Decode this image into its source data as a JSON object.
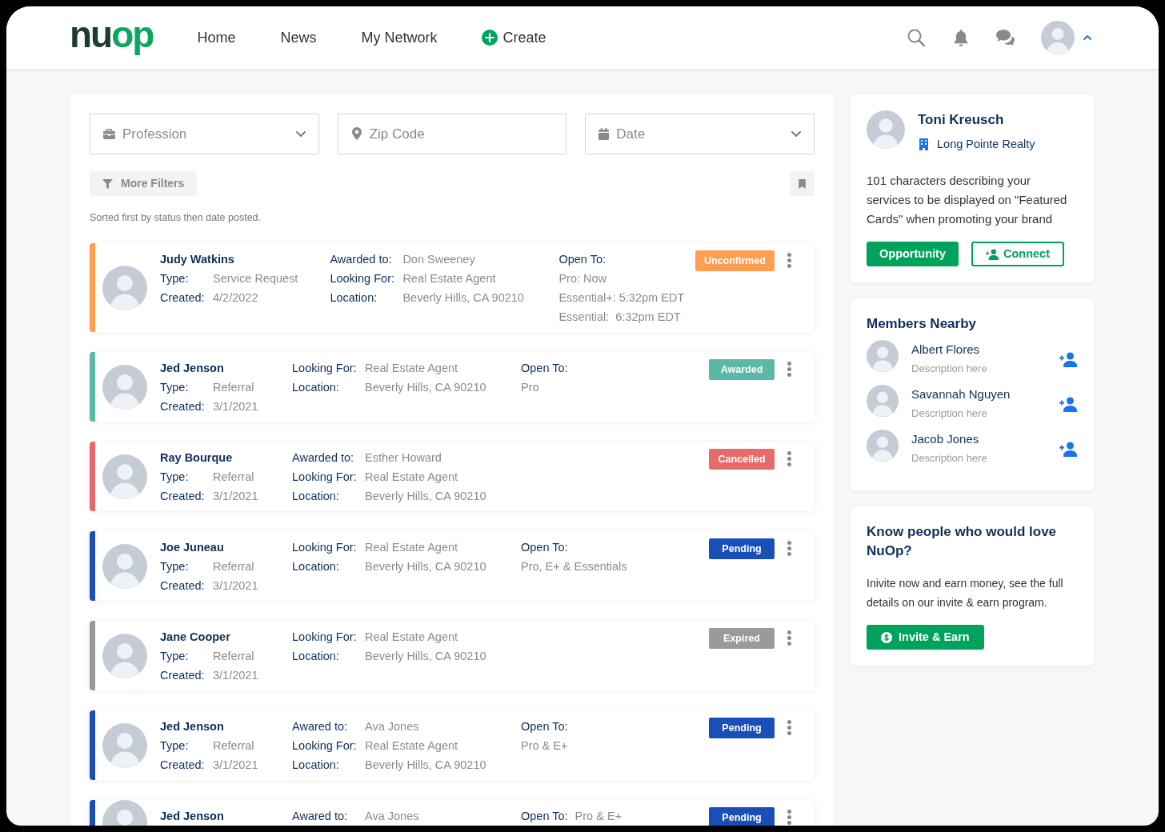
{
  "header": {
    "logo": {
      "text": "nu",
      "accent": "op"
    },
    "nav": [
      {
        "label": "Home",
        "kind": "link"
      },
      {
        "label": "News",
        "kind": "link"
      },
      {
        "label": "My Network",
        "kind": "link"
      },
      {
        "label": "Create",
        "kind": "create"
      }
    ]
  },
  "filters": {
    "profession": {
      "placeholder": "Profession"
    },
    "zip_code": {
      "placeholder": "Zip Code"
    },
    "date": {
      "placeholder": "Date"
    },
    "more_filters": "More Filters"
  },
  "sort_note": "Sorted first by status then date posted.",
  "listings": [
    {
      "name": "Judy Watkins",
      "status": "Unconfirmed",
      "color": "#fd9e52",
      "details": [
        {
          "label": "Type:",
          "value": "Service Request"
        },
        {
          "label": "Created:",
          "value": "4/2/2022"
        }
      ],
      "terms": [
        {
          "label": "Awarded to:",
          "value": "Don Sweeney"
        },
        {
          "label": "Looking For:",
          "value": "Real Estate Agent"
        },
        {
          "label": "Location:",
          "value": "Beverly Hills, CA 90210"
        }
      ],
      "open_to": {
        "label": "Open To:",
        "values": [
          "Pro: Now",
          "Essential+: 5:32pm EDT",
          "Essential:  6:32pm EDT"
        ],
        "inline": false
      }
    },
    {
      "name": "Jed Jenson",
      "status": "Awarded",
      "color": "#5cb8a6",
      "details": [
        {
          "label": "Type:",
          "value": "Referral"
        },
        {
          "label": "Created:",
          "value": "3/1/2021"
        }
      ],
      "terms": [
        {
          "label": "Looking For:",
          "value": "Real Estate Agent"
        },
        {
          "label": "Location:",
          "value": "Beverly Hills, CA 90210"
        }
      ],
      "open_to": {
        "label": "Open To:",
        "values": [
          "Pro"
        ],
        "inline": false
      }
    },
    {
      "name": "Ray Bourque",
      "status": "Cancelled",
      "color": "#e66a6a",
      "details": [
        {
          "label": "Type:",
          "value": "Referral"
        },
        {
          "label": "Created:",
          "value": "3/1/2021"
        }
      ],
      "terms": [
        {
          "label": "Awarded to:",
          "value": "Esther Howard"
        },
        {
          "label": "Looking For:",
          "value": "Real Estate Agent"
        },
        {
          "label": "Location:",
          "value": "Beverly Hills, CA 90210"
        }
      ]
    },
    {
      "name": "Joe Juneau",
      "status": "Pending",
      "color": "#1b4fb8",
      "details": [
        {
          "label": "Type:",
          "value": "Referral"
        },
        {
          "label": "Created:",
          "value": "3/1/2021"
        }
      ],
      "terms": [
        {
          "label": "Looking For:",
          "value": "Real Estate Agent"
        },
        {
          "label": "Location:",
          "value": "Beverly Hills, CA 90210"
        }
      ],
      "open_to": {
        "label": "Open To:",
        "values": [
          "Pro, E+ & Essentials"
        ],
        "inline": false
      }
    },
    {
      "name": "Jane Cooper",
      "status": "Expired",
      "color": "#9a9a9a",
      "details": [
        {
          "label": "Type:",
          "value": "Referral"
        },
        {
          "label": "Created:",
          "value": "3/1/2021"
        }
      ],
      "terms": [
        {
          "label": "Looking For:",
          "value": "Real Estate Agent"
        },
        {
          "label": "Location:",
          "value": "Beverly Hills, CA 90210"
        }
      ]
    },
    {
      "name": "Jed Jenson",
      "status": "Pending",
      "color": "#1b4fb8",
      "details": [
        {
          "label": "Type:",
          "value": "Referral"
        },
        {
          "label": "Created:",
          "value": "3/1/2021"
        }
      ],
      "terms": [
        {
          "label": "Awared to:",
          "value": "Ava Jones"
        },
        {
          "label": "Looking For:",
          "value": "Real Estate Agent"
        },
        {
          "label": "Location:",
          "value": "Beverly Hills, CA 90210"
        }
      ],
      "open_to": {
        "label": "Open To:",
        "values": [
          "Pro & E+"
        ],
        "inline": false
      }
    },
    {
      "name": "Jed Jenson",
      "status": "Pending",
      "color": "#1b4fb8",
      "terms": [
        {
          "label": "Awared to:",
          "value": "Ava Jones"
        }
      ],
      "open_to": {
        "label": "Open To:",
        "values": [
          "Pro & E+"
        ],
        "inline": true
      }
    }
  ],
  "profile_card": {
    "name": "Toni Kreusch",
    "company": "Long Pointe Realty",
    "bio": "101 characters describing your services to be displayed on \"Featured Cards\" when promoting your brand",
    "buttons": [
      {
        "label": "Opportunity",
        "kind": "primary"
      },
      {
        "label": "Connect",
        "kind": "connect"
      }
    ]
  },
  "members_nearby": {
    "title": "Members Nearby",
    "members": [
      {
        "name": "Albert Flores",
        "description": "Description here"
      },
      {
        "name": "Savannah Nguyen",
        "description": "Description here"
      },
      {
        "name": "Jacob Jones",
        "description": "Description here"
      }
    ]
  },
  "invite_card": {
    "title": "Know people who would love NuOp?",
    "text": "Inivite now and earn money, see the full details on our invite & earn program.",
    "button": "Invite & Earn"
  }
}
